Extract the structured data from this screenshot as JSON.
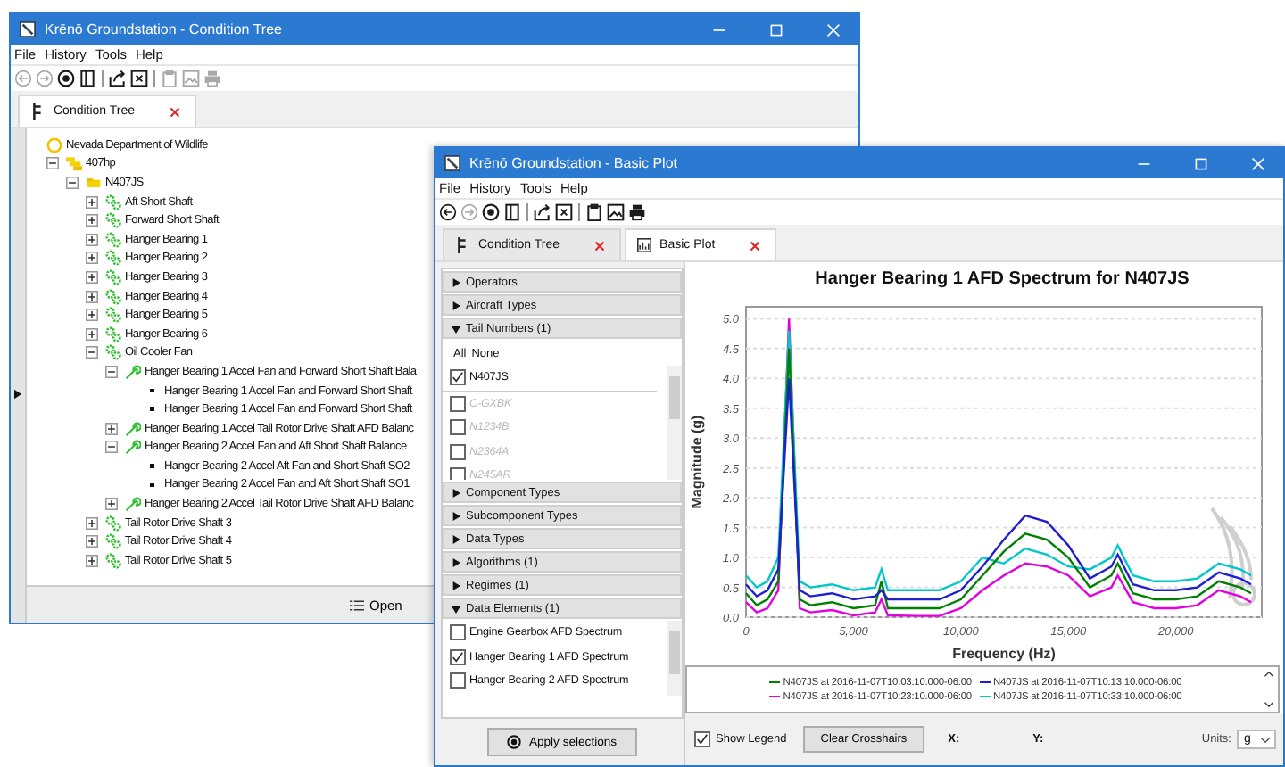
{
  "condition_tree_window": {
    "title": "Krēnō Groundstation - Condition Tree",
    "menu": [
      "File",
      "History",
      "Tools",
      "Help"
    ],
    "toolbar": [
      {
        "kind": "back",
        "disabled": true
      },
      {
        "kind": "forward",
        "disabled": true
      },
      {
        "kind": "record",
        "disabled": false
      },
      {
        "kind": "panel",
        "disabled": false
      },
      {
        "kind": "separator"
      },
      {
        "kind": "export",
        "disabled": false
      },
      {
        "kind": "close-box",
        "disabled": false
      },
      {
        "kind": "separator"
      },
      {
        "kind": "clipboard",
        "disabled": true
      },
      {
        "kind": "image",
        "disabled": true
      },
      {
        "kind": "printer",
        "disabled": true
      }
    ],
    "tabs": [
      {
        "label": "Condition Tree",
        "selected": true
      }
    ],
    "tree": [
      {
        "label": "Nevada Department of Wildlife",
        "kind": "org",
        "children": [
          {
            "label": "407hp",
            "kind": "fleet",
            "expanded": true,
            "children": [
              {
                "label": "N407JS",
                "kind": "aircraft",
                "expanded": true,
                "children": [
                  {
                    "label": "Aft Short Shaft",
                    "kind": "component",
                    "expanded": false
                  },
                  {
                    "label": "Forward Short Shaft",
                    "kind": "component",
                    "expanded": false
                  },
                  {
                    "label": "Hanger Bearing 1",
                    "kind": "component",
                    "expanded": false
                  },
                  {
                    "label": "Hanger Bearing 2",
                    "kind": "component",
                    "expanded": false
                  },
                  {
                    "label": "Hanger Bearing 3",
                    "kind": "component",
                    "expanded": false
                  },
                  {
                    "label": "Hanger Bearing 4",
                    "kind": "component",
                    "expanded": false
                  },
                  {
                    "label": "Hanger Bearing 5",
                    "kind": "component",
                    "expanded": false
                  },
                  {
                    "label": "Hanger Bearing 6",
                    "kind": "component",
                    "expanded": false
                  },
                  {
                    "label": "Oil Cooler Fan",
                    "kind": "component",
                    "expanded": true,
                    "children": [
                      {
                        "label": "Hanger Bearing 1 Accel Fan and Forward Short Shaft Bala",
                        "kind": "algorithm",
                        "expanded": true,
                        "children": [
                          {
                            "label": "Hanger Bearing 1 Accel Fan and Forward Short Shaft",
                            "kind": "element"
                          },
                          {
                            "label": "Hanger Bearing 1 Accel Fan and Forward Short Shaft",
                            "kind": "element"
                          }
                        ]
                      },
                      {
                        "label": "Hanger Bearing 1 Accel Tail Rotor Drive Shaft AFD Balanc",
                        "kind": "algorithm",
                        "expanded": false
                      },
                      {
                        "label": "Hanger Bearing 2 Accel Fan and Aft Short Shaft Balance",
                        "kind": "algorithm",
                        "expanded": true,
                        "children": [
                          {
                            "label": "Hanger Bearing 2 Accel Aft Fan and Short Shaft SO2",
                            "kind": "element"
                          },
                          {
                            "label": "Hanger Bearing 2 Accel Fan and Aft Short Shaft SO1",
                            "kind": "element"
                          }
                        ]
                      },
                      {
                        "label": "Hanger Bearing 2 Accel Tail Rotor Drive Shaft AFD Balanc",
                        "kind": "algorithm",
                        "expanded": false
                      }
                    ]
                  },
                  {
                    "label": "Tail Rotor Drive Shaft 3",
                    "kind": "component",
                    "expanded": false
                  },
                  {
                    "label": "Tail Rotor Drive Shaft 4",
                    "kind": "component",
                    "expanded": false
                  },
                  {
                    "label": "Tail Rotor Drive Shaft 5",
                    "kind": "component",
                    "expanded": false
                  }
                ]
              }
            ]
          }
        ]
      }
    ],
    "open_button": "Open"
  },
  "basic_plot_window": {
    "title": "Krēnō Groundstation - Basic Plot",
    "menu": [
      "File",
      "History",
      "Tools",
      "Help"
    ],
    "toolbar": [
      {
        "kind": "back",
        "disabled": false
      },
      {
        "kind": "forward",
        "disabled": true
      },
      {
        "kind": "record",
        "disabled": false
      },
      {
        "kind": "panel",
        "disabled": false
      },
      {
        "kind": "separator"
      },
      {
        "kind": "export",
        "disabled": false
      },
      {
        "kind": "close-box",
        "disabled": false
      },
      {
        "kind": "separator"
      },
      {
        "kind": "clipboard",
        "disabled": false
      },
      {
        "kind": "image",
        "disabled": false
      },
      {
        "kind": "printer",
        "disabled": false
      }
    ],
    "tabs": [
      {
        "label": "Condition Tree",
        "selected": false,
        "kind": "tree"
      },
      {
        "label": "Basic Plot",
        "selected": true,
        "kind": "plot"
      }
    ],
    "filters": [
      {
        "label": "Operators",
        "expanded": false
      },
      {
        "label": "Aircraft Types",
        "expanded": false
      },
      {
        "label": "Tail Numbers (1)",
        "expanded": true,
        "links": [
          "All",
          "None"
        ],
        "items": [
          {
            "label": "N407JS",
            "checked": true,
            "disabled": false
          },
          {
            "label": "C-GXBK",
            "checked": false,
            "disabled": true
          },
          {
            "label": "N1234B",
            "checked": false,
            "disabled": true
          },
          {
            "label": "N2364A",
            "checked": false,
            "disabled": true
          },
          {
            "label": "N245AR",
            "checked": false,
            "disabled": true
          }
        ]
      },
      {
        "label": "Component Types",
        "expanded": false
      },
      {
        "label": "Subcomponent Types",
        "expanded": false
      },
      {
        "label": "Data Types",
        "expanded": false
      },
      {
        "label": "Algorithms (1)",
        "expanded": false
      },
      {
        "label": "Regimes (1)",
        "expanded": false
      },
      {
        "label": "Data Elements (1)",
        "expanded": true,
        "items": [
          {
            "label": "Engine Gearbox AFD Spectrum",
            "checked": false,
            "disabled": false
          },
          {
            "label": "Hanger Bearing 1 AFD Spectrum",
            "checked": true,
            "disabled": false
          },
          {
            "label": "Hanger Bearing 2 AFD Spectrum",
            "checked": false,
            "disabled": false
          }
        ]
      }
    ],
    "apply_button": "Apply selections",
    "chart_data": {
      "type": "line",
      "title": "Hanger Bearing 1 AFD Spectrum for N407JS",
      "xlabel": "Frequency (Hz)",
      "ylabel": "Magnitude (g)",
      "x": [
        0,
        500,
        1000,
        1500,
        2000,
        2500,
        3000,
        4000,
        5000,
        6000,
        6300,
        6600,
        8000,
        9000,
        10000,
        11000,
        12000,
        13000,
        14000,
        15000,
        16000,
        17000,
        17300,
        18000,
        19000,
        20000,
        21000,
        22000,
        23000,
        23500
      ],
      "series": [
        {
          "name": "N407JS at 2016-11-07T10:03:10.000-06:00",
          "color": "#008000",
          "values": [
            0.4,
            0.2,
            0.3,
            0.6,
            4.5,
            0.3,
            0.2,
            0.25,
            0.15,
            0.2,
            0.6,
            0.15,
            0.15,
            0.15,
            0.3,
            0.7,
            1.1,
            1.4,
            1.3,
            1.0,
            0.5,
            0.7,
            0.9,
            0.4,
            0.3,
            0.3,
            0.35,
            0.6,
            0.5,
            0.4
          ]
        },
        {
          "name": "N407JS at 2016-11-07T10:13:10.000-06:00",
          "color": "#1f1fd0",
          "values": [
            0.55,
            0.35,
            0.45,
            0.8,
            4.0,
            0.45,
            0.35,
            0.4,
            0.3,
            0.35,
            0.45,
            0.3,
            0.3,
            0.3,
            0.45,
            0.85,
            1.3,
            1.7,
            1.6,
            1.2,
            0.65,
            0.85,
            1.05,
            0.55,
            0.45,
            0.45,
            0.5,
            0.75,
            0.65,
            0.55
          ]
        },
        {
          "name": "N407JS at 2016-11-07T10:23:10.000-06:00",
          "color": "#e000e0",
          "values": [
            0.25,
            0.08,
            0.15,
            0.45,
            5.0,
            0.15,
            0.08,
            0.12,
            0.03,
            0.08,
            0.3,
            0.03,
            0.02,
            0.02,
            0.15,
            0.45,
            0.7,
            0.9,
            0.85,
            0.7,
            0.35,
            0.5,
            0.7,
            0.25,
            0.15,
            0.15,
            0.2,
            0.45,
            0.35,
            0.25
          ]
        },
        {
          "name": "N407JS at 2016-11-07T10:33:10.000-06:00",
          "color": "#00c8c8",
          "values": [
            0.7,
            0.5,
            0.6,
            1.0,
            4.8,
            0.6,
            0.5,
            0.55,
            0.45,
            0.5,
            0.8,
            0.45,
            0.45,
            0.45,
            0.6,
            1.0,
            0.9,
            1.15,
            1.05,
            0.85,
            0.8,
            1.0,
            1.2,
            0.7,
            0.6,
            0.6,
            0.65,
            0.9,
            0.8,
            0.7
          ]
        }
      ],
      "xlim": [
        0,
        24000
      ],
      "ylim": [
        0,
        5.2
      ],
      "grid": true,
      "xticks": [
        {
          "value": 0,
          "label": "0"
        },
        {
          "value": 5000,
          "label": "5,000"
        },
        {
          "value": 10000,
          "label": "10,000"
        },
        {
          "value": 15000,
          "label": "15,000"
        },
        {
          "value": 20000,
          "label": "20,000"
        }
      ],
      "yticks": [
        {
          "value": 0,
          "label": "0.0"
        },
        {
          "value": 0.5,
          "label": "0.5"
        },
        {
          "value": 1,
          "label": "1.0"
        },
        {
          "value": 1.5,
          "label": "1.5"
        },
        {
          "value": 2,
          "label": "2.0"
        },
        {
          "value": 2.5,
          "label": "2.5"
        },
        {
          "value": 3,
          "label": "3.0"
        },
        {
          "value": 3.5,
          "label": "3.5"
        },
        {
          "value": 4,
          "label": "4.0"
        },
        {
          "value": 4.5,
          "label": "4.5"
        },
        {
          "value": 5,
          "label": "5.0"
        }
      ]
    },
    "show_legend": {
      "label": "Show Legend",
      "checked": true
    },
    "clear_button": "Clear Crosshairs",
    "x_readout": "X:",
    "y_readout": "Y:",
    "units": {
      "label": "Units:",
      "value": "g"
    }
  }
}
